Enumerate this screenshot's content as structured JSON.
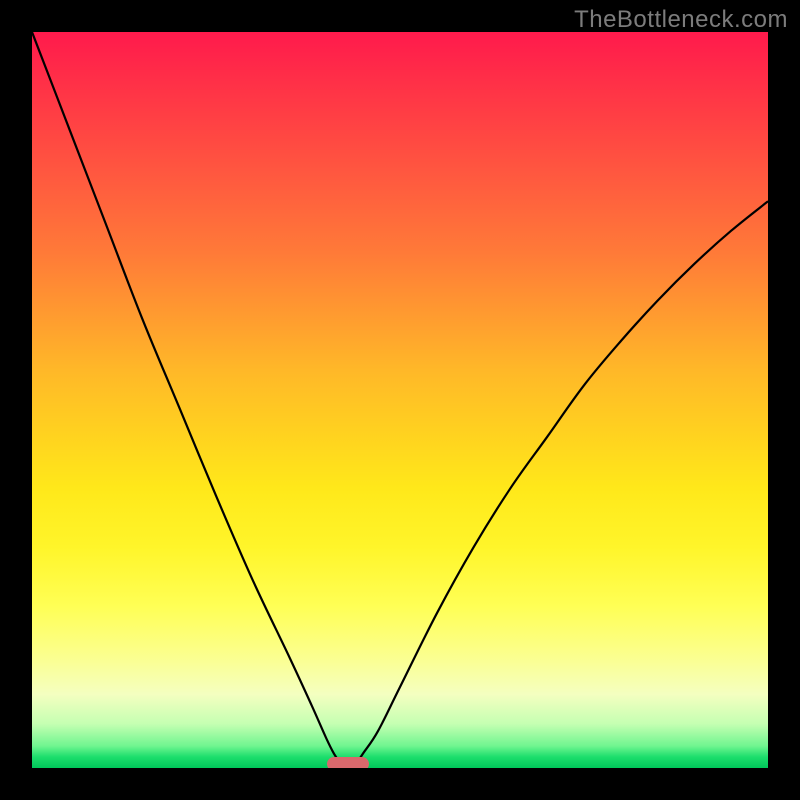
{
  "watermark": "TheBottleneck.com",
  "colors": {
    "frame": "#000000",
    "curve": "#000000",
    "marker": "#D9686C",
    "gradient_top": "#FF1A4C",
    "gradient_bottom": "#00C75A"
  },
  "chart_data": {
    "type": "line",
    "title": "",
    "xlabel": "",
    "ylabel": "",
    "xlim": [
      0,
      100
    ],
    "ylim": [
      0,
      100
    ],
    "series": [
      {
        "name": "left-curve",
        "x": [
          0,
          5,
          10,
          15,
          20,
          25,
          30,
          35,
          38,
          40,
          41,
          42
        ],
        "y": [
          100,
          87,
          74,
          61,
          49,
          37,
          25.5,
          15,
          8.5,
          4,
          2,
          0.5
        ]
      },
      {
        "name": "right-curve",
        "x": [
          44,
          45,
          47,
          50,
          55,
          60,
          65,
          70,
          75,
          80,
          85,
          90,
          95,
          100
        ],
        "y": [
          0.5,
          2,
          5,
          11,
          21,
          30,
          38,
          45,
          52,
          58,
          63.5,
          68.5,
          73,
          77
        ]
      }
    ],
    "marker": {
      "x": 43,
      "y": 0.5
    },
    "grid": false,
    "legend": false
  }
}
